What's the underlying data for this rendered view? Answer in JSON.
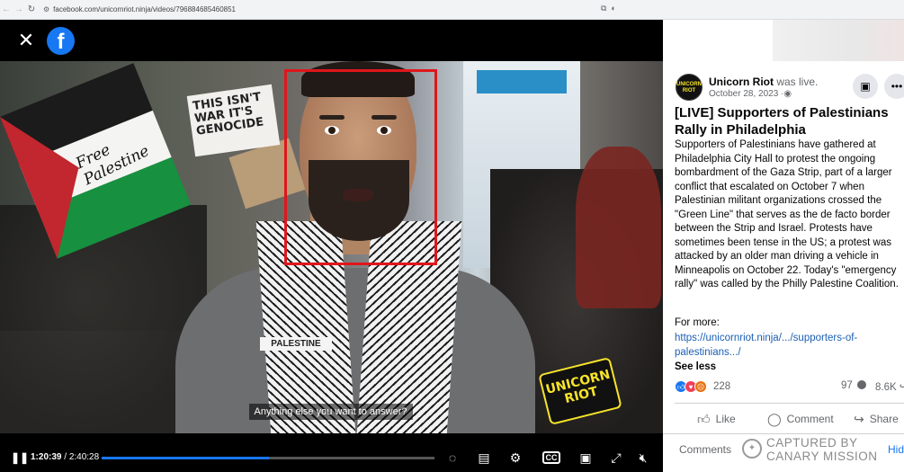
{
  "browser": {
    "url": "facebook.com/unicornriot.ninja/videos/796884685460851"
  },
  "video": {
    "close_glyph": "✕",
    "logo_glyph": "f",
    "flag_text": "Free Palestine",
    "sign_text": "THIS ISN'T WAR IT'S GENOCIDE",
    "scarf_text": "PALESTINE",
    "watermark_line1": "UNICORN",
    "watermark_line2": "RIOT",
    "caption": "Anything else you want to answer?",
    "current_time": "1:20:39",
    "total_time": "2:40:28",
    "progress": 0.503,
    "cc_label": "CC",
    "face_box_color": "#e0161b"
  },
  "post": {
    "author": "Unicorn Riot",
    "status": "was live.",
    "date": "October 28, 2023",
    "avatar_line1": "UNICORN",
    "avatar_line2": "RIOT",
    "title": "[LIVE] Supporters of Palestinians Rally in Philadelphia",
    "body": "Supporters of Palestinians have gathered at Philadelphia City Hall to protest the ongoing bombardment of the Gaza Strip, part of a larger conflict that escalated on October 7 when Palestinian militant organizations crossed the \"Green Line\" that serves as the de facto border between the Strip and Israel. Protests have sometimes been tense in the US; a protest was attacked by an older man driving a vehicle in Minneapolis on October 22. Today's \"emergency rally\" was called by the Philly Palestine Coalition.",
    "for_more": "For more:",
    "link": "https://unicornriot.ninja/.../supporters-of-palestinians.../",
    "see_less": "See less",
    "reaction_count": "228",
    "comment_count": "97",
    "share_count": "8.6K",
    "actions": {
      "like": "Like",
      "comment": "Comment",
      "share": "Share"
    },
    "comments_tab": "Comments",
    "hidden_tab": "Hid"
  },
  "overlay": {
    "line1": "CAPTURED BY",
    "line2": "CANARY MISSION"
  }
}
